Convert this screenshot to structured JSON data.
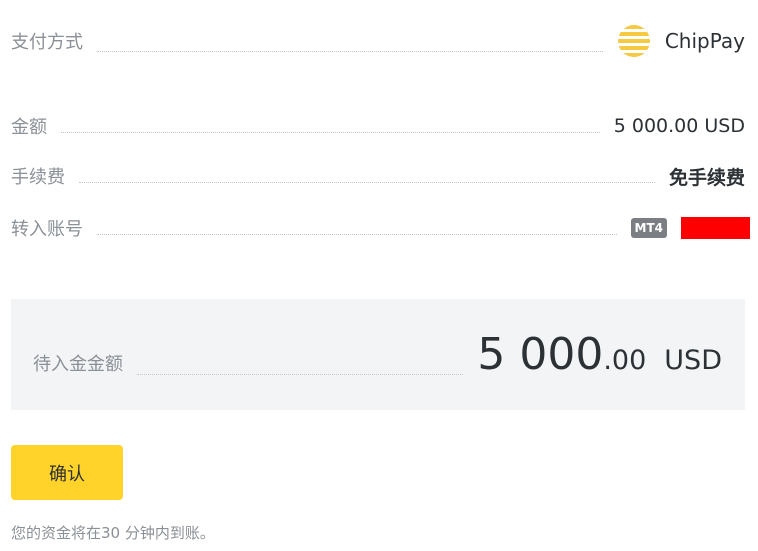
{
  "payment_method": {
    "label": "支付方式",
    "provider": "ChipPay",
    "icon": "chippay-logo-icon"
  },
  "amount": {
    "label": "金额",
    "value": "5 000.00 USD"
  },
  "fee": {
    "label": "手续费",
    "value": "免手续费"
  },
  "account": {
    "label": "转入账号",
    "badge": "MT4",
    "redacted_color": "#ff0000"
  },
  "summary": {
    "label": "待入金金额",
    "amount_int": "5 000",
    "amount_dec": ".00",
    "currency": "USD"
  },
  "confirm_label": "确认",
  "note": "您的资金将在30 分钟内到账。",
  "colors": {
    "accent": "#ffd32a",
    "summary_bg": "#f3f4f6",
    "logo": "#f5c940"
  }
}
